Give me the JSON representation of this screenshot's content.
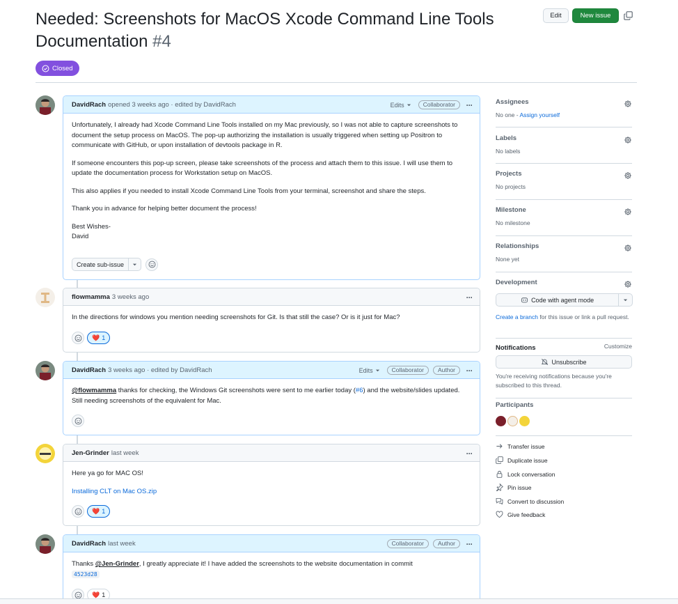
{
  "issue": {
    "title": "Needed: Screenshots for MacOS Xcode Command Line Tools Documentation",
    "number": "#4",
    "state": "Closed",
    "edit_label": "Edit",
    "new_issue_label": "New issue"
  },
  "comments": [
    {
      "author": "DavidRach",
      "meta": "opened 3 weeks ago · edited by DavidRach",
      "edits_label": "Edits",
      "badges": [
        "Collaborator"
      ],
      "paragraphs": [
        "Unfortunately, I already had Xcode Command Line Tools installed on my Mac previously, so I was not able to capture screenshots to document the setup process on MacOS. The pop-up authorizing the installation is usually triggered when setting up Positron to communicate with GitHub, or upon installation of devtools package in R.",
        "If someone encounters this pop-up screen, please take screenshots of the process and attach them to this issue. I will use them to update the documentation process for Workstation setup on MacOS.",
        "This also applies if you needed to install Xcode Command Line Tools from your terminal, screenshot and share the steps.",
        "Thank you in advance for helping better document the process!"
      ],
      "signoff_1": "Best Wishes-",
      "signoff_2": "David",
      "subissue_label": "Create sub-issue"
    },
    {
      "author": "flowmamma",
      "meta": "3 weeks ago",
      "text": "In the directions for windows you mention needing screenshots for Git. Is that still the case? Or is it just for Mac?",
      "reaction_count": "1"
    },
    {
      "author": "DavidRach",
      "meta": "3 weeks ago · edited by DavidRach",
      "edits_label": "Edits",
      "badges": [
        "Collaborator",
        "Author"
      ],
      "mention": "@flowmamma",
      "text_a": " thanks for checking, the Windows Git screenshots were sent to me earlier today (",
      "link": "#6",
      "text_b": ") and the website/slides updated. Still needing screenshots of the equivalent for Mac."
    },
    {
      "author": "Jen-Grinder",
      "meta": "last week",
      "text": "Here ya go for MAC OS!",
      "attachment": "Installing CLT on Mac OS.zip",
      "reaction_count": "1"
    },
    {
      "author": "DavidRach",
      "meta": "last week",
      "badges": [
        "Collaborator",
        "Author"
      ],
      "text_a": "Thanks ",
      "mention": "@Jen-Grinder",
      "text_b": ", I greatly appreciate it! I have added the screenshots to the website documentation in commit ",
      "commit": "4523d28",
      "reaction_count": "1"
    }
  ],
  "sidebar": {
    "assignees": {
      "title": "Assignees",
      "value": "No one - ",
      "link": "Assign yourself"
    },
    "labels": {
      "title": "Labels",
      "value": "No labels"
    },
    "projects": {
      "title": "Projects",
      "value": "No projects"
    },
    "milestone": {
      "title": "Milestone",
      "value": "No milestone"
    },
    "relationships": {
      "title": "Relationships",
      "value": "None yet"
    },
    "development": {
      "title": "Development",
      "agent_button": "Code with agent mode",
      "branch_link": "Create a branch",
      "branch_text": " for this issue or link a pull request."
    },
    "notifications": {
      "title": "Notifications",
      "customize": "Customize",
      "unsubscribe": "Unsubscribe",
      "note": "You're receiving notifications because you're subscribed to this thread."
    },
    "participants": {
      "title": "Participants"
    },
    "actions": [
      "Transfer issue",
      "Duplicate issue",
      "Lock conversation",
      "Pin issue",
      "Convert to discussion",
      "Give feedback"
    ]
  },
  "colors": {
    "closed": "#8250df",
    "new_issue": "#1f883d",
    "link": "#0969da"
  }
}
